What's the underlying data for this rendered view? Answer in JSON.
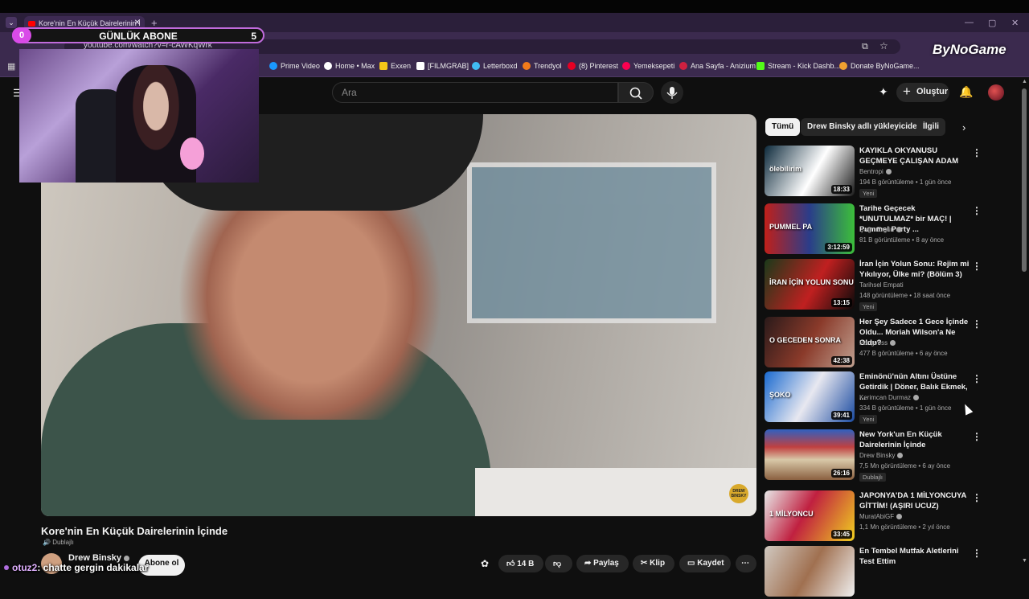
{
  "browser": {
    "tab_title": "Kore'nin En Küçük Dairelerinin İ",
    "url": "youtube.com/watch?v=r-cAWKqWrk",
    "bookmarks": [
      "Prime Video",
      "Home • Max",
      "Exxen",
      "[FILMGRAB]",
      "Letterboxd",
      "Trendyol",
      "(8) Pinterest",
      "Yemeksepeti",
      "Ana Sayfa - Anizium",
      "Stream - Kick Dashb...",
      "Donate ByNoGame..."
    ]
  },
  "overlay": {
    "counter_left": "0",
    "counter_title": "GÜNLÜK ABONE",
    "counter_right": "5",
    "chat_user": "otuz2",
    "chat_message": ": chatte gergin dakikalar",
    "brand": "ByNoGame"
  },
  "header": {
    "search_placeholder": "Ara",
    "create_label": "Oluştur"
  },
  "video": {
    "title": "Kore'nin En Küçük Dairelerinin İçinde",
    "dub_label": "Dublajlı",
    "channel": "Drew Binsky",
    "subscribe_label": "Abone ol",
    "likes": "14 B",
    "share_label": "Paylaş",
    "clip_label": "Klip",
    "save_label": "Kaydet",
    "watermark": "DREW BINSKY"
  },
  "chips": [
    "Tümü",
    "Drew Binsky adlı yükleyiciden",
    "İlgili"
  ],
  "recommendations": [
    {
      "title": "KAYIKLA OKYANUSU GEÇMEYE ÇALIŞAN ADAM",
      "channel": "Bentropi",
      "meta": "194 B görüntüleme • 1 gün önce",
      "badge": "Yeni",
      "duration": "18:33",
      "thumb_bg": "linear-gradient(120deg,#0d2a3c,#ffffff 55%,#1a1a1a)",
      "thumb_text": "ölebilirim"
    },
    {
      "title": "Tarihe Geçecek *UNUTULMAZ* bir MAÇ! | Pummel Party ...",
      "channel": "Çağrı Ergün",
      "meta": "81 B görüntüleme • 8 ay önce",
      "badge": "",
      "duration": "3:12:59",
      "thumb_bg": "linear-gradient(90deg,#c0201a,#2a3d8a 50%,#3cbf3a)",
      "thumb_text": "PUMMEL PA"
    },
    {
      "title": "İran İçin Yolun Sonu: Rejim mi Yıkılıyor, Ülke mi? (Bölüm 3)",
      "channel": "Tarihsel Empati",
      "meta": "148 görüntüleme • 18 saat önce",
      "badge": "Yeni",
      "duration": "13:15",
      "thumb_bg": "linear-gradient(120deg,#1a3a1a,#c02020 55%,#0a0a0a)",
      "thumb_text": "İRAN İÇİN YOLUN SONU"
    },
    {
      "title": "Her Şey Sadece 1 Gece İçinde Oldu... Moriah Wilson'a Ne Oldu?",
      "channel": "Pangvoss",
      "meta": "477 B görüntüleme • 6 ay önce",
      "badge": "",
      "duration": "42:38",
      "thumb_bg": "linear-gradient(120deg,#2a1a1a,#8a3a2a 50%,#c0a090)",
      "thumb_text": "O GECEDEN SONRA"
    },
    {
      "title": "Eminönü'nün Altını Üstüne Getirdik | Döner, Balık Ekmek, ...",
      "channel": "Kerimcan Durmaz",
      "meta": "334 B görüntüleme • 1 gün önce",
      "badge": "Yeni",
      "duration": "39:41",
      "thumb_bg": "linear-gradient(120deg,#1a6ad0,#e8e8f0 50%,#1a4aa0)",
      "thumb_text": "ŞOKO"
    },
    {
      "title": "New York'un En Küçük Dairelerinin İçinde",
      "channel": "Drew Binsky",
      "meta": "7,5 Mn görüntüleme • 6 ay önce",
      "badge": "Dublajlı",
      "duration": "26:16",
      "thumb_bg": "linear-gradient(180deg,#3060c0,#c04040 35%,#d8c8a8 60%,#8a6040)",
      "thumb_text": ""
    },
    {
      "title": "JAPONYA'DA 1 MİLYONCUYA GİTTİM! (AŞIRI UCUZ)",
      "channel": "MuratAbiGF",
      "meta": "1,1 Mn görüntüleme • 2 yıl önce",
      "badge": "",
      "duration": "33:45",
      "thumb_bg": "linear-gradient(120deg,#e8e8e8,#c02040 45%,#f0d020)",
      "thumb_text": "1 MİLYONCU"
    },
    {
      "title": "En Tembel Mutfak Aletlerini Test Ettim",
      "channel": "",
      "meta": "",
      "badge": "",
      "duration": "",
      "thumb_bg": "linear-gradient(120deg,#d0c8c0,#a07050 50%,#f0f0f0)",
      "thumb_text": ""
    }
  ]
}
